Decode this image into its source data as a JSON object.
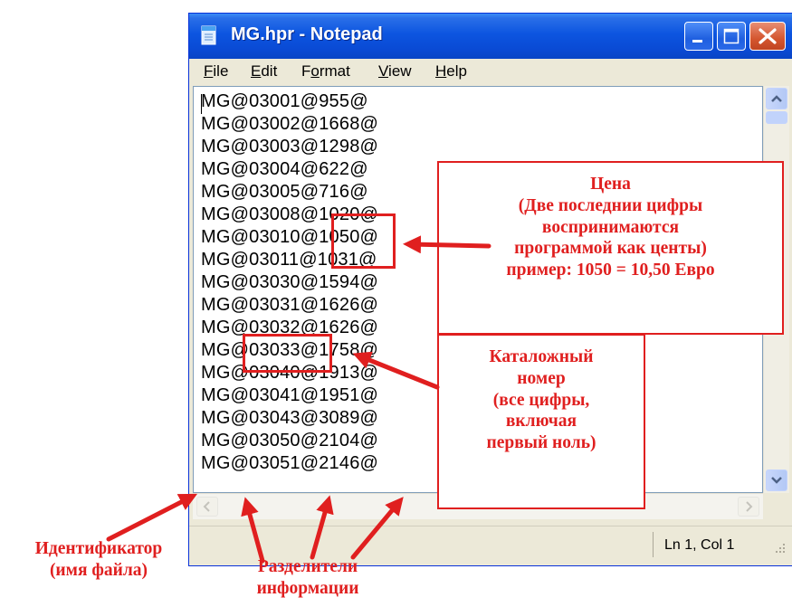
{
  "window": {
    "title": "MG.hpr - Notepad",
    "accent_color": "#0c55e0",
    "icon": "notepad-icon",
    "controls": [
      "minimize-icon",
      "maximize-icon",
      "close-icon"
    ]
  },
  "menu": {
    "items": [
      {
        "accel": "F",
        "rest": "ile"
      },
      {
        "accel": "E",
        "rest": "dit"
      },
      {
        "pre": "F",
        "accel": "o",
        "rest": "rmat"
      },
      {
        "accel": "V",
        "rest": "iew"
      },
      {
        "accel": "H",
        "rest": "elp"
      }
    ]
  },
  "editor": {
    "lines": [
      "MG@03001@955@",
      "MG@03002@1668@",
      "MG@03003@1298@",
      "MG@03004@622@",
      "MG@03005@716@",
      "MG@03008@1020@",
      "MG@03010@1050@",
      "MG@03011@1031@",
      "MG@03030@1594@",
      "MG@03031@1626@",
      "MG@03032@1626@",
      "MG@03033@1758@",
      "MG@03040@1913@",
      "MG@03041@1951@",
      "MG@03043@3089@",
      "MG@03050@2104@",
      "MG@03051@2146@"
    ]
  },
  "status": {
    "position": "Ln 1, Col 1"
  },
  "annotations": {
    "color": "#e01f1f",
    "price": [
      "Цена",
      "(Две последнии цифры",
      "воспринимаются",
      "программой как центы)",
      "пример: 1050 = 10,50 Евро"
    ],
    "catalog": [
      "Каталожный",
      "номер",
      "(все цифры,",
      "включая",
      "первый ноль)"
    ],
    "identifier": [
      "Идентификатор",
      "(имя файла)"
    ],
    "separators": [
      "Разделители",
      "информации"
    ]
  }
}
